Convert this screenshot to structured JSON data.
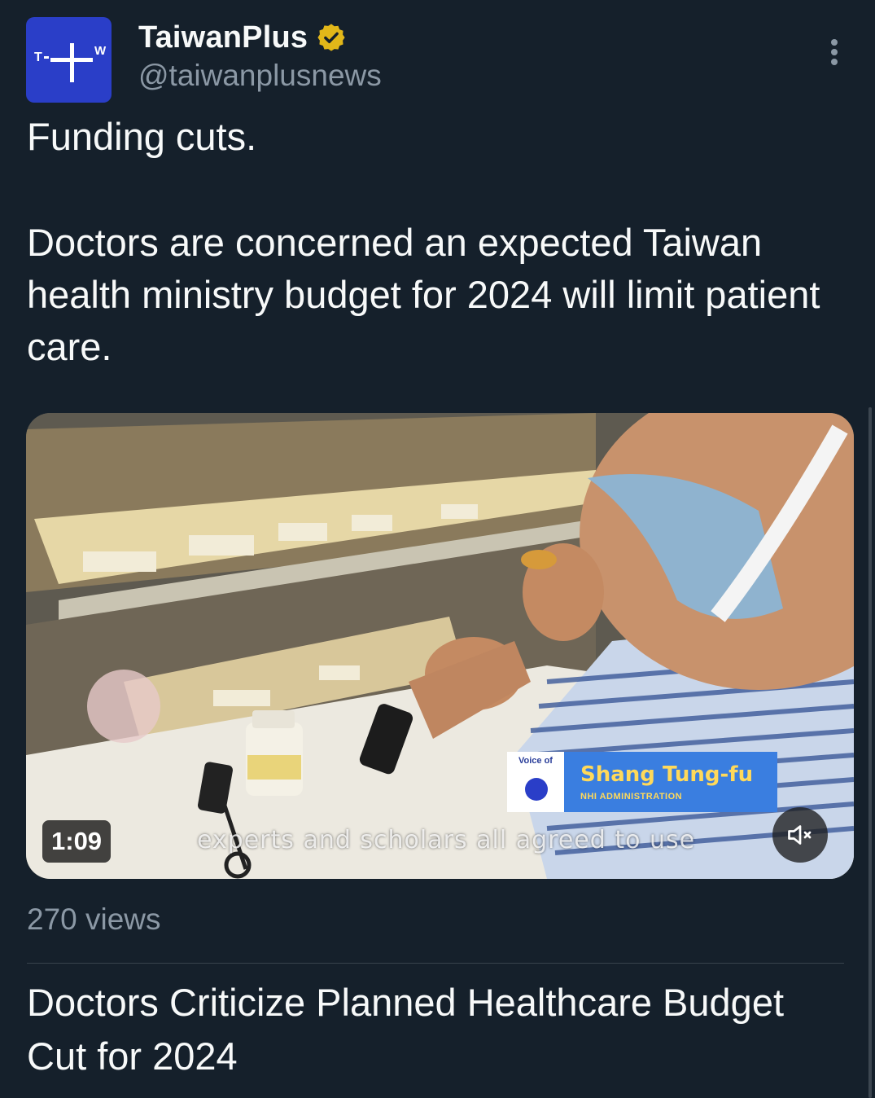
{
  "author": {
    "display_name": "TaiwanPlus",
    "handle": "@taiwanplusnews",
    "avatar_text_left": "T",
    "avatar_text_right": "W"
  },
  "tweet": {
    "paragraphs": [
      "Funding cuts.",
      "Doctors are concerned an expected Taiwan health ministry budget for 2024 will limit patient care."
    ]
  },
  "video": {
    "duration": "1:09",
    "lower_third": {
      "voice_label": "Voice of",
      "name": "Shang Tung-fu",
      "title": "NHI ADMINISTRATION"
    },
    "subtitle": "experts and scholars all agreed to use"
  },
  "stats": {
    "views": "270 views"
  },
  "card": {
    "title": "Doctors Criticize Planned Healthcare Budget Cut for 2024"
  },
  "colors": {
    "background": "#15202b",
    "text": "#f7f9f9",
    "muted": "#8b98a5",
    "verified": "#e2b719",
    "brand": "#2a3ec8"
  }
}
